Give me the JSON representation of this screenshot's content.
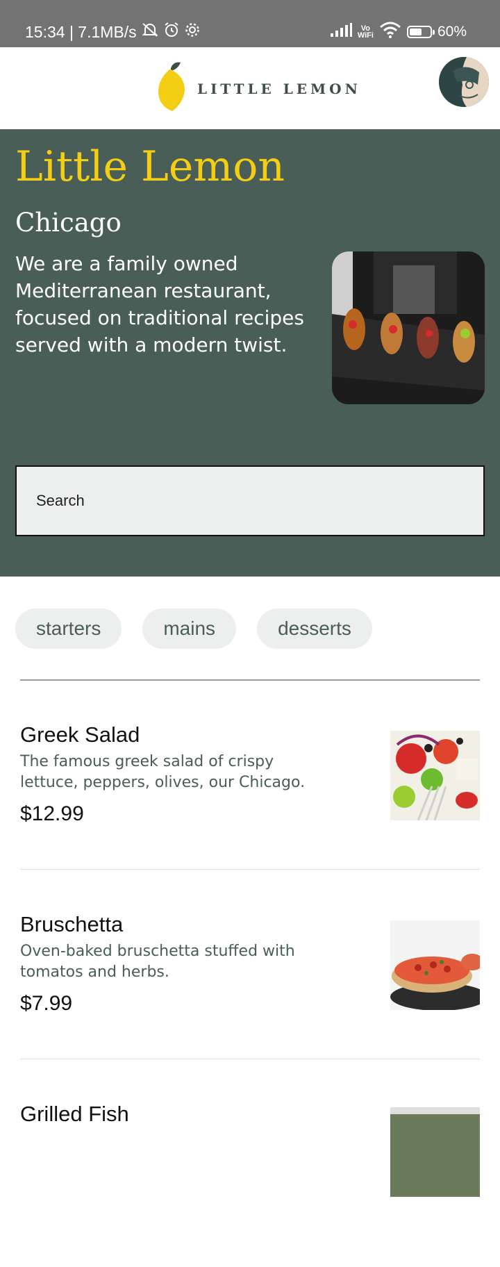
{
  "status_bar": {
    "time_speed": "15:34 | 7.1MB/s",
    "vowifi_line1": "Vo",
    "vowifi_line2": "WiFi",
    "battery": "60%",
    "battery_level": 0.6
  },
  "header": {
    "logo_text": "LITTLE LEMON"
  },
  "hero": {
    "title": "Little Lemon",
    "city": "Chicago",
    "description": "We are a family owned Mediterranean restaurant, focused on traditional recipes served with a modern twist.",
    "search_placeholder": "Search"
  },
  "categories": [
    "starters",
    "mains",
    "desserts"
  ],
  "menu": [
    {
      "name": "Greek Salad",
      "description": "The famous greek salad of crispy lettuce, peppers, olives, our Chicago.",
      "price": "$12.99"
    },
    {
      "name": "Bruschetta",
      "description": "Oven-baked bruschetta stuffed with tomatos and herbs.",
      "price": "$7.99"
    },
    {
      "name": "Grilled Fish",
      "description": "",
      "price": ""
    }
  ],
  "colors": {
    "primary_green": "#495e57",
    "primary_yellow": "#f4ce14",
    "chip_bg": "#edefee"
  }
}
